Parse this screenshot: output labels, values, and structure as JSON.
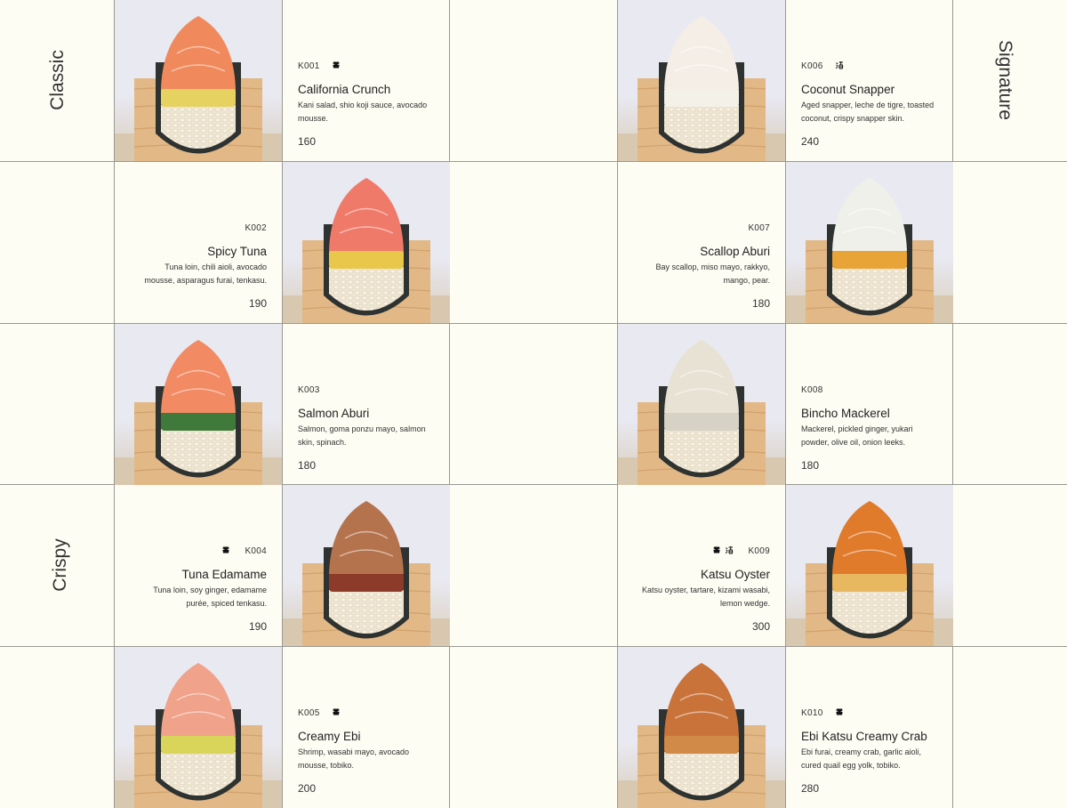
{
  "sections": {
    "classic": "Classic",
    "crispy": "Crispy",
    "signature": "Signature"
  },
  "items": [
    {
      "code": "K001",
      "name": "California Crunch",
      "desc": "Kani salad, shio koji sauce, avocado mousse.",
      "price": "160",
      "icons": [
        "shell-icon"
      ]
    },
    {
      "code": "K002",
      "name": "Spicy Tuna",
      "desc": "Tuna loin, chili aioli, avocado mousse, asparagus furai, tenkasu.",
      "price": "190",
      "icons": []
    },
    {
      "code": "K003",
      "name": "Salmon Aburi",
      "desc": "Salmon, goma ponzu mayo, salmon skin, spinach.",
      "price": "180",
      "icons": []
    },
    {
      "code": "K004",
      "name": "Tuna Edamame",
      "desc": "Tuna loin, soy ginger, edamame purée, spiced tenkasu.",
      "price": "190",
      "icons": [
        "shell-icon"
      ]
    },
    {
      "code": "K005",
      "name": "Creamy Ebi",
      "desc": "Shrimp, wasabi mayo, avocado mousse, tobiko.",
      "price": "200",
      "icons": [
        "shell-icon"
      ]
    },
    {
      "code": "K006",
      "name": "Coconut Snapper",
      "desc": "Aged snapper, leche de tigre, toasted coconut, crispy snapper skin.",
      "price": "240",
      "icons": [
        "kanji-icon"
      ]
    },
    {
      "code": "K007",
      "name": "Scallop Aburi",
      "desc": "Bay scallop, miso mayo, rakkyo, mango, pear.",
      "price": "180",
      "icons": []
    },
    {
      "code": "K008",
      "name": "Bincho Mackerel",
      "desc": "Mackerel, pickled ginger, yukari powder, olive oil, onion leeks.",
      "price": "180",
      "icons": []
    },
    {
      "code": "K009",
      "name": "Katsu Oyster",
      "desc": "Katsu oyster, tartare, kizami wasabi, lemon wedge.",
      "price": "300",
      "icons": [
        "shell-icon",
        "kanji-icon"
      ]
    },
    {
      "code": "K010",
      "name": "Ebi Katsu Creamy Crab",
      "desc": "Ebi furai, creamy crab, garlic aioli, cured quail egg yolk, tobiko.",
      "price": "280",
      "icons": [
        "shell-icon"
      ]
    }
  ],
  "colors": {
    "background": "#fdfdf3",
    "gridline": "#9a9a94",
    "wood": "#e2b887",
    "rice": "#efe6d2",
    "nori": "#2e3230"
  },
  "toppings": [
    "#f08a5d",
    "#f07a6a",
    "#f28a63",
    "#b5734d",
    "#f0a28a",
    "#f4eee6",
    "#f0f0ea",
    "#e8e2d4",
    "#e07b2c",
    "#c9733a"
  ],
  "fillings": [
    "#e6d260",
    "#e8c74a",
    "#3f7a3a",
    "#8c3a2a",
    "#d9d45a",
    "#f4f1e8",
    "#e8a436",
    "#d6d2c6",
    "#e8b860",
    "#d28a48"
  ]
}
